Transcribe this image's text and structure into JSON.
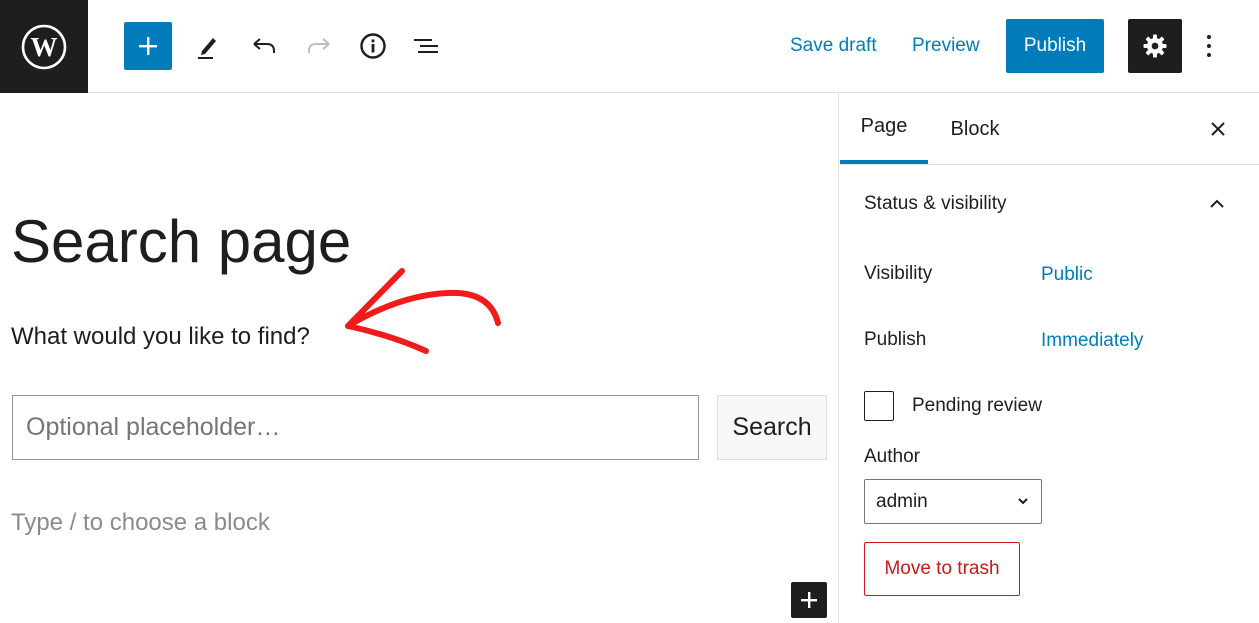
{
  "toolbar": {
    "logo_icon": "wordpress-logo-icon",
    "add_block_icon": "plus-icon",
    "tools_icon": "pencil-icon",
    "undo_icon": "undo-icon",
    "redo_icon": "redo-icon",
    "details_icon": "info-icon",
    "outline_icon": "list-view-icon",
    "save_draft_label": "Save draft",
    "preview_label": "Preview",
    "publish_label": "Publish",
    "settings_icon": "gear-icon",
    "more_icon": "vertical-ellipsis-icon",
    "accent_color": "#007cba"
  },
  "editor": {
    "title": "Search page",
    "paragraph": "What would you like to find?",
    "search_placeholder": "Optional placeholder…",
    "search_button_label": "Search",
    "block_hint": "Type / to choose a block",
    "annotation_color": "#f01c1c",
    "inserter_icon": "plus-icon"
  },
  "sidebar": {
    "tabs": [
      {
        "label": "Page",
        "active": true
      },
      {
        "label": "Block",
        "active": false
      }
    ],
    "close_icon": "close-icon",
    "panel": {
      "title": "Status & visibility",
      "expanded": true,
      "visibility_label": "Visibility",
      "visibility_value": "Public",
      "publish_label": "Publish",
      "publish_value": "Immediately",
      "pending_review_label": "Pending review",
      "pending_review_checked": false,
      "author_label": "Author",
      "author_value": "admin",
      "trash_label": "Move to trash",
      "danger_color": "#cc1818"
    }
  }
}
